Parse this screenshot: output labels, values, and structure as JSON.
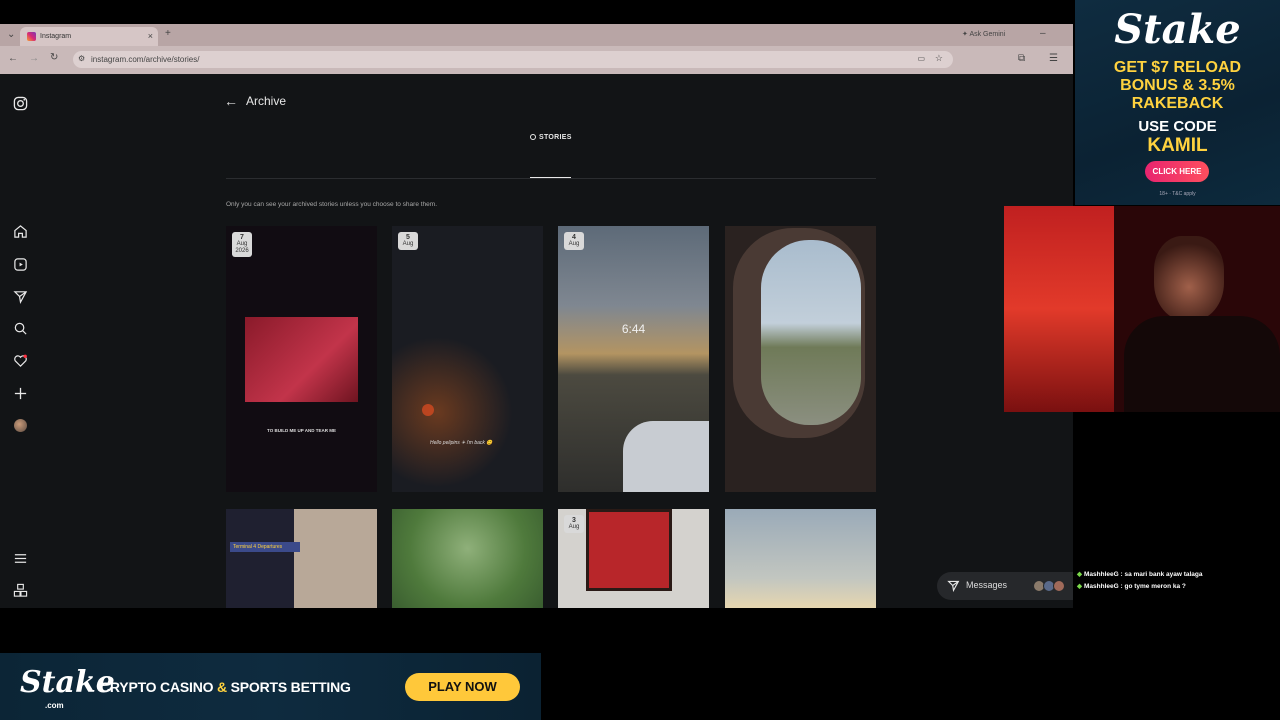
{
  "browser": {
    "tab_title": "Instagram",
    "url": "instagram.com/archive/stories/",
    "gemini_label": "Ask Gemini"
  },
  "page": {
    "title": "Archive",
    "tab_label": "STORIES",
    "hint": "Only you can see your archived stories unless you choose to share them."
  },
  "stories": [
    {
      "day": "7",
      "month": "Aug",
      "year": "2026",
      "caption": "TO BUILD ME UP AND TEAR ME"
    },
    {
      "day": "5",
      "month": "Aug",
      "year": "",
      "caption": "Hello pelipins ✈ i'm back 😊"
    },
    {
      "day": "4",
      "month": "Aug",
      "year": "",
      "caption": "6:44"
    },
    {
      "day": "",
      "month": "",
      "year": "",
      "caption": ""
    },
    {
      "day": "",
      "month": "",
      "year": "",
      "caption": "Terminal 4 Departures"
    },
    {
      "day": "",
      "month": "",
      "year": "",
      "caption": ""
    },
    {
      "day": "3",
      "month": "Aug",
      "year": "",
      "caption": ""
    },
    {
      "day": "",
      "month": "",
      "year": "",
      "caption": ""
    }
  ],
  "messages": {
    "label": "Messages"
  },
  "stake_ad": {
    "logo": "Stake",
    "line1": "GET $7 RELOAD",
    "line2": "BONUS & 3.5%",
    "line3": "RAKEBACK",
    "line4": "USE CODE",
    "code": "KAMIL",
    "button": "CLICK HERE",
    "fine_print": "18+ · T&C apply"
  },
  "chat": [
    {
      "user": "MashhleeG",
      "text": "sa mari bank ayaw talaga"
    },
    {
      "user": "MashhleeG",
      "text": "go tyme meron ka ?"
    }
  ],
  "bottom_ad": {
    "logo": "Stake",
    "logo_sub": ".com",
    "text_a": "CRYPTO CASINO ",
    "text_amp": "&",
    "text_b": " SPORTS BETTING",
    "button": "PLAY NOW"
  },
  "colors": {
    "accent_yellow": "#ffd23f",
    "stake_bg": "#0f2c40",
    "ig_bg": "#121416"
  }
}
